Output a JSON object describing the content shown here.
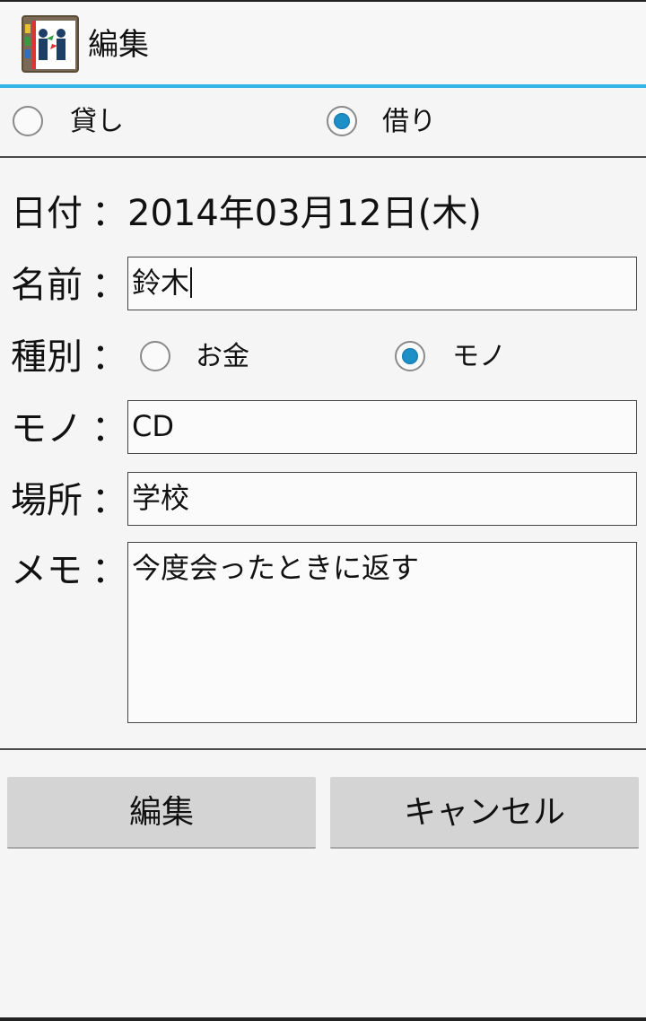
{
  "actionbar": {
    "title": "編集",
    "icon": "app-logo-icon"
  },
  "type_radio": {
    "options": [
      {
        "label": "貸し",
        "checked": false
      },
      {
        "label": "借り",
        "checked": true
      }
    ]
  },
  "form": {
    "date": {
      "label": "日付",
      "value": "2014年03月12日(木)"
    },
    "name": {
      "label": "名前",
      "value": "鈴木"
    },
    "kind": {
      "label": "種別",
      "options": [
        {
          "label": "お金",
          "checked": false
        },
        {
          "label": "モノ",
          "checked": true
        }
      ]
    },
    "item": {
      "label": "モノ",
      "value": "CD"
    },
    "place": {
      "label": "場所",
      "value": "学校"
    },
    "memo": {
      "label": "メモ",
      "value": "今度会ったときに返す"
    },
    "colon": "："
  },
  "buttons": {
    "edit": "編集",
    "cancel": "キャンセル"
  },
  "colors": {
    "accent": "#33b5e5",
    "radio_fill": "#1e90c8",
    "button_bg": "#d4d4d4",
    "background": "#f5f5f5"
  }
}
